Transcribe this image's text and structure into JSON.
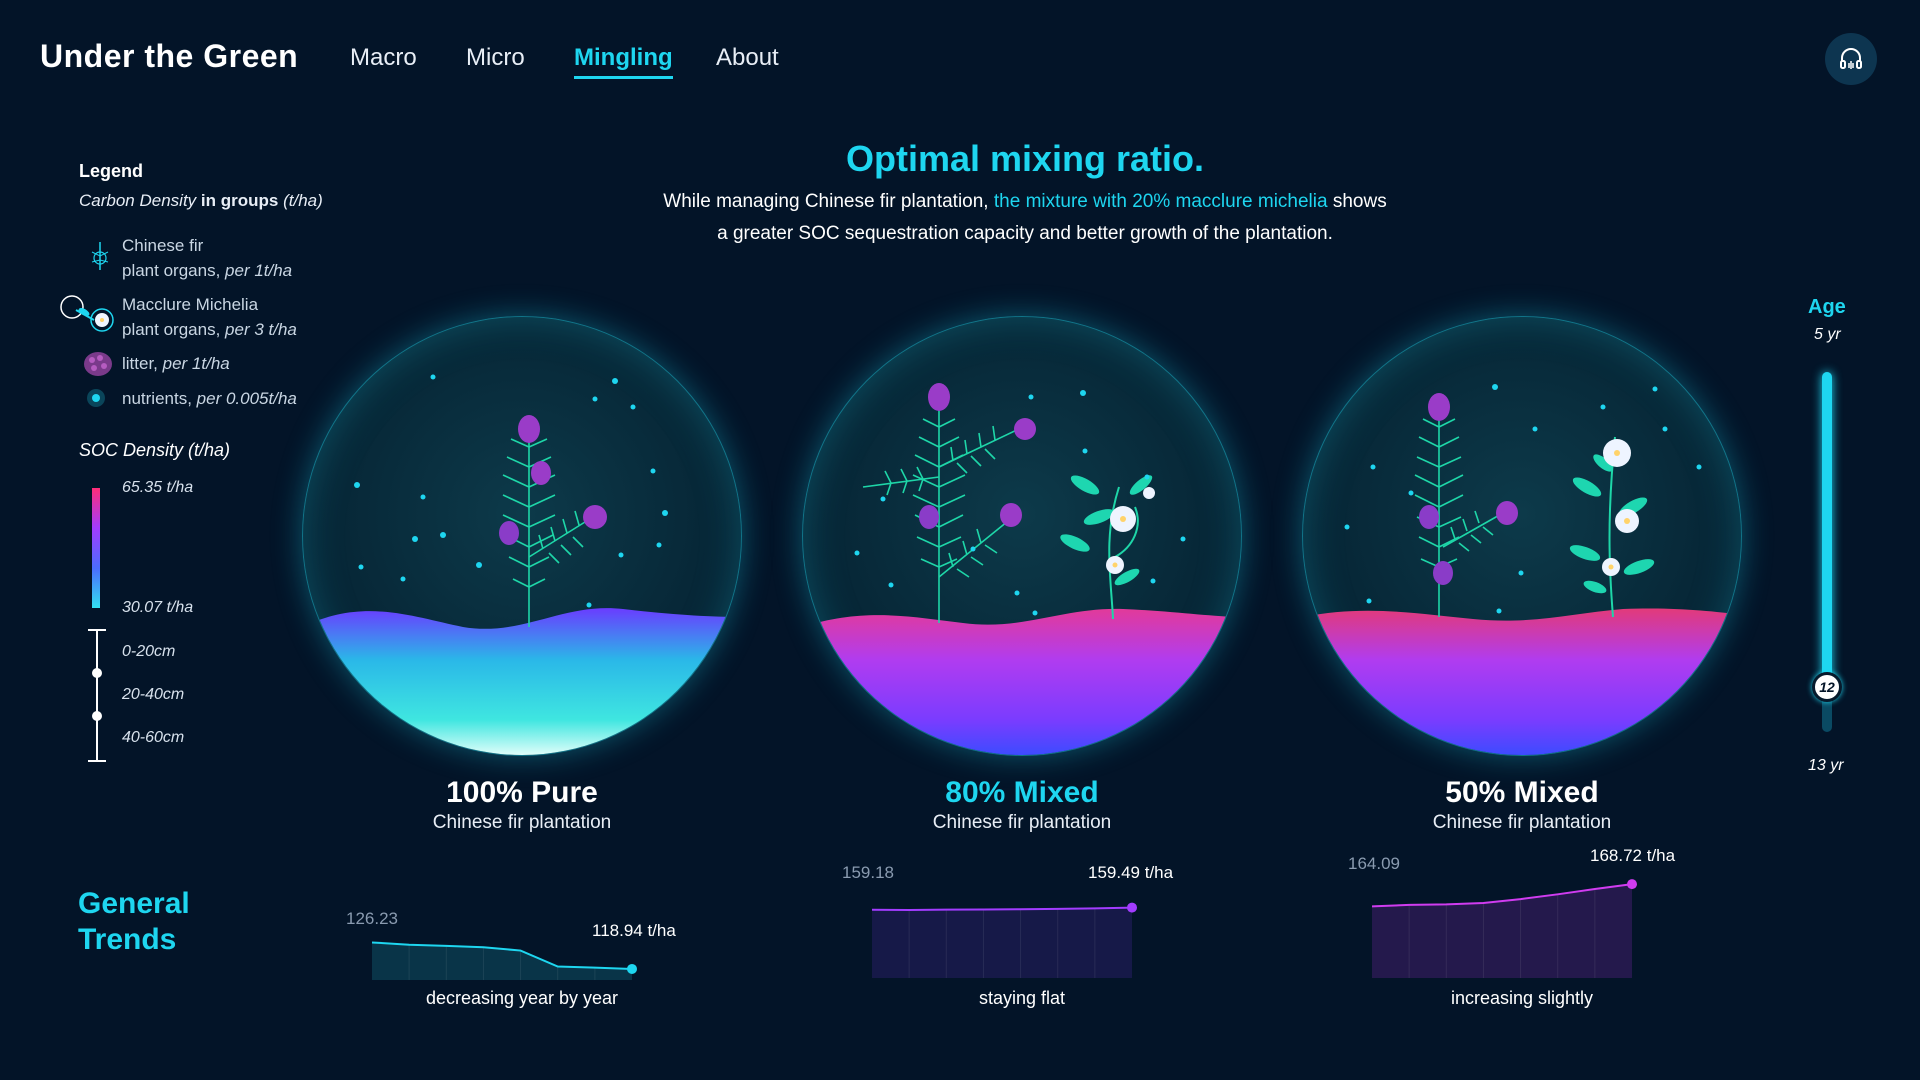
{
  "header": {
    "brand": "Under the Green",
    "nav": [
      "Macro",
      "Micro",
      "Mingling",
      "About"
    ],
    "active_nav": "Mingling",
    "audio_icon": "headphones-icon"
  },
  "hero": {
    "title": "Optimal mixing ratio.",
    "sub_1": "While managing Chinese fir plantation, ",
    "sub_highlight": "the mixture with 20% macclure michelia",
    "sub_2": " shows",
    "sub_3": "a greater SOC sequestration capacity and better growth of the plantation."
  },
  "legend": {
    "title": "Legend",
    "sub_italic": "Carbon Density",
    "sub_bold": "in groups",
    "sub_unit": "(t/ha)",
    "items": [
      {
        "name": "Chinese fir",
        "desc": "plant organs,",
        "unit": "per 1t/ha",
        "icon": "fir-icon"
      },
      {
        "name": "Macclure Michelia",
        "desc": "plant organs,",
        "unit": "per 3 t/ha",
        "icon": "michelia-flower-icon"
      },
      {
        "name": "litter,",
        "desc": "",
        "unit": "per 1t/ha",
        "icon": "litter-icon"
      },
      {
        "name": "nutrients,",
        "desc": "",
        "unit": "per 0.005t/ha",
        "icon": "nutrient-dot-icon"
      }
    ],
    "soc_title": "SOC Density (t/ha)",
    "soc_max": "65.35 t/ha",
    "soc_min": "30.07 t/ha",
    "depths": [
      "0-20cm",
      "20-40cm",
      "40-60cm"
    ]
  },
  "orbs": [
    {
      "title": "100% Pure",
      "subtitle": "Chinese fir plantation",
      "title_color": "#ffffff"
    },
    {
      "title": "80% Mixed",
      "subtitle": "Chinese fir plantation",
      "title_color": "#1ed6f0"
    },
    {
      "title": "50% Mixed",
      "subtitle": "Chinese fir plantation",
      "title_color": "#ffffff"
    }
  ],
  "age": {
    "title": "Age",
    "min": "5 yr",
    "max": "13 yr",
    "value": "12",
    "fraction": 0.875
  },
  "trends": {
    "title_1": "General",
    "title_2": "Trends"
  },
  "chart_data": [
    {
      "type": "area",
      "x": [
        5,
        6,
        7,
        8,
        9,
        10,
        11,
        12
      ],
      "values": [
        126.23,
        125.6,
        125.3,
        124.9,
        124.0,
        119.6,
        119.3,
        118.94
      ],
      "start_label": "126.23",
      "end_label": "118.94 t/ha",
      "caption": "decreasing year by year",
      "color": "#1ed6f0"
    },
    {
      "type": "area",
      "x": [
        5,
        6,
        7,
        8,
        9,
        10,
        11,
        12
      ],
      "values": [
        159.18,
        159.15,
        159.2,
        159.22,
        159.25,
        159.3,
        159.38,
        159.49
      ],
      "start_label": "159.18",
      "end_label": "159.49 t/ha",
      "caption": "staying flat",
      "color": "#a23cff"
    },
    {
      "type": "area",
      "x": [
        5,
        6,
        7,
        8,
        9,
        10,
        11,
        12
      ],
      "values": [
        164.09,
        164.4,
        164.5,
        164.8,
        165.6,
        166.6,
        167.7,
        168.72
      ],
      "start_label": "164.09",
      "end_label": "168.72 t/ha",
      "caption": "increasing slightly",
      "color": "#d03cf0"
    }
  ]
}
